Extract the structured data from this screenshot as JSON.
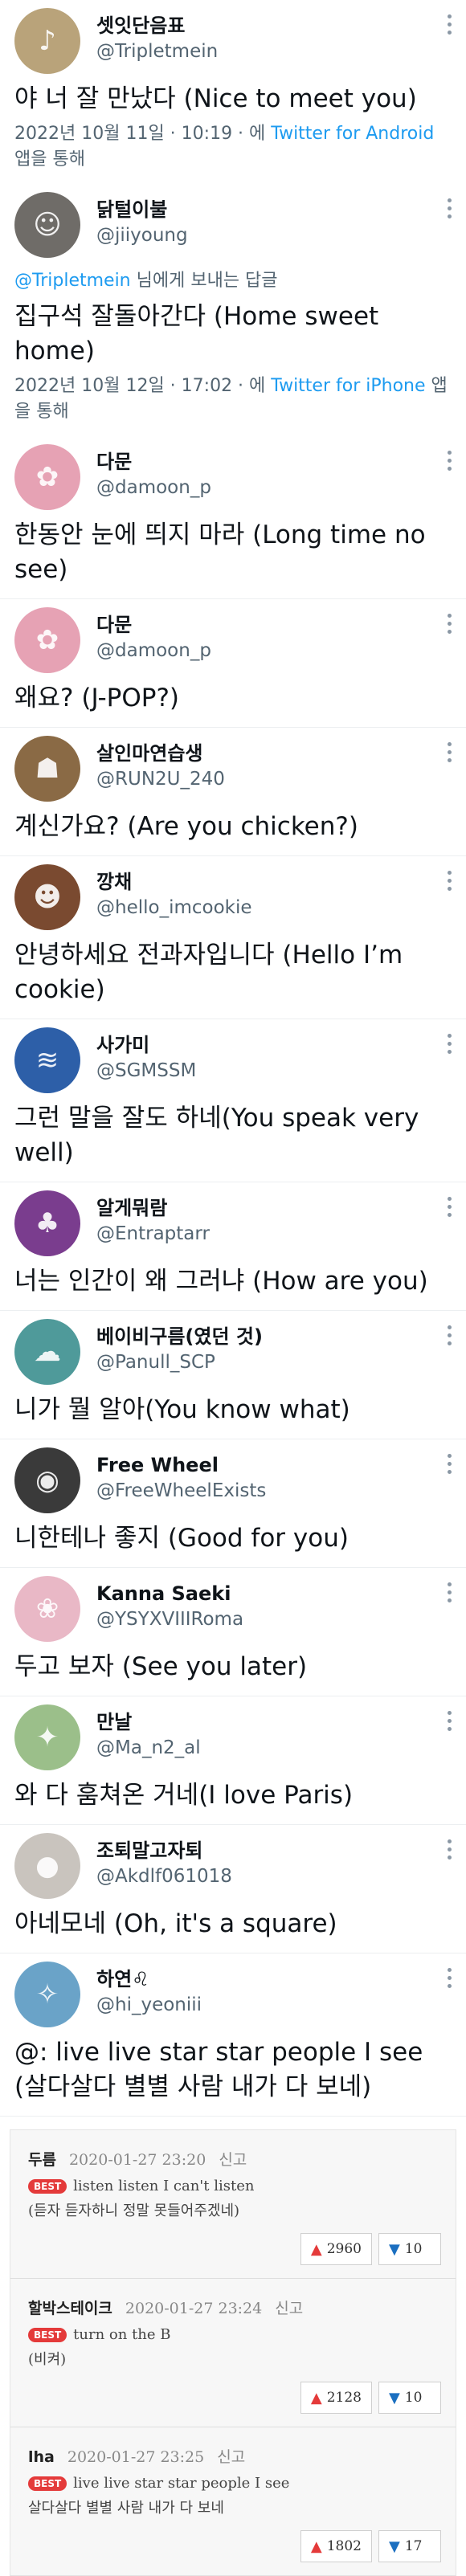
{
  "thread": [
    {
      "name": "셋잇단음표",
      "handle": "@Tripletmein",
      "text": "야 너 잘 만났다 (Nice to meet you)",
      "meta_prefix": "2022년 10월 11일 · 10:19 · 에 ",
      "meta_via": "Twitter for Android",
      "meta_suffix": " 앱을 통해",
      "avatar": {
        "bg": "#b9a37a",
        "glyph": "♪"
      }
    },
    {
      "name": "닭털이불",
      "handle": "@jiiyoung",
      "reply_handle": "@Tripletmein",
      "reply_suffix": " 님에게 보내는 답글",
      "text": "집구석 잘돌아간다 (Home sweet home)",
      "meta_prefix": "2022년 10월 12일 · 17:02 · 에 ",
      "meta_via": "Twitter for iPhone",
      "meta_suffix": " 앱을 통해",
      "avatar": {
        "bg": "#6f6c68",
        "glyph": "☺"
      }
    },
    {
      "name": "다문",
      "handle": "@damoon_p",
      "text": "한동안 눈에 띄지 마라 (Long time no see)",
      "avatar": {
        "bg": "#e6a2b4",
        "glyph": "✿"
      }
    },
    {
      "name": "다문",
      "handle": "@damoon_p",
      "text": "왜요? (J-POP?)",
      "avatar": {
        "bg": "#e6a2b4",
        "glyph": "✿"
      }
    },
    {
      "name": "살인마연습생",
      "handle": "@RUN2U_240",
      "text": "계신가요? (Are you chicken?)",
      "avatar": {
        "bg": "#8a6a45",
        "glyph": "☗"
      }
    },
    {
      "name": "깡채",
      "handle": "@hello_imcookie",
      "text": "안녕하세요 전과자입니다 (Hello I’m cookie)",
      "avatar": {
        "bg": "#7a4a30",
        "glyph": "☻"
      }
    },
    {
      "name": "사가미",
      "handle": "@SGMSSM",
      "text": "그런 말을 잘도 하네(You speak very well)",
      "avatar": {
        "bg": "#2d5fa8",
        "glyph": "≋"
      }
    },
    {
      "name": "알게뭐람",
      "handle": "@Entraptarr",
      "text": "너는 인간이 왜 그러냐 (How are you)",
      "avatar": {
        "bg": "#7a3d8e",
        "glyph": "♣"
      }
    },
    {
      "name": "베이비구름(였던 것)",
      "handle": "@Panull_SCP",
      "text": "니가 뭘 알아(You know what)",
      "avatar": {
        "bg": "#4f9a9a",
        "glyph": "☁"
      }
    },
    {
      "name": "Free Wheel",
      "handle": "@FreeWheelExists",
      "text": "니한테나 좋지 (Good for you)",
      "avatar": {
        "bg": "#3a3a3a",
        "glyph": "◉"
      }
    },
    {
      "name": "Kanna Saeki",
      "handle": "@YSYXVIIIRoma",
      "text": "두고 보자 (See you later)",
      "avatar": {
        "bg": "#e9b8c6",
        "glyph": "❀"
      }
    },
    {
      "name": "만날",
      "handle": "@Ma_n2_al",
      "text": "와 다 훔쳐온 거네(I love Paris)",
      "avatar": {
        "bg": "#9bbf8a",
        "glyph": "✦"
      }
    },
    {
      "name": "조퇴말고자퇴",
      "handle": "@Akdlf061018",
      "text": "아네모네 (Oh, it's a square)",
      "avatar": {
        "bg": "#c9c4be",
        "glyph": "●"
      }
    },
    {
      "name": "하연♌︎",
      "handle": "@hi_yeoniii",
      "text": "@: live live star star people I see (살다살다 별별 사람 내가 다 보네)",
      "avatar": {
        "bg": "#6aa3c8",
        "glyph": "✧"
      }
    }
  ],
  "comments": [
    {
      "name": "두름",
      "date": "2020-01-27 23:20",
      "report": "신고",
      "best": "BEST",
      "text": "listen listen I can't listen",
      "sub": "(듣자 듣자하니 정말 못들어주겠네)",
      "up": "2960",
      "down": "10"
    },
    {
      "name": "할박스테이크",
      "date": "2020-01-27 23:24",
      "report": "신고",
      "best": "BEST",
      "text": "turn on the B",
      "sub": "(비켜)",
      "up": "2128",
      "down": "10"
    },
    {
      "name": "lha",
      "date": "2020-01-27 23:25",
      "report": "신고",
      "best": "BEST",
      "text": "live live star star people I see",
      "sub": "살다살다 별별 사람 내가 다 보네",
      "up": "1802",
      "down": "17"
    }
  ]
}
